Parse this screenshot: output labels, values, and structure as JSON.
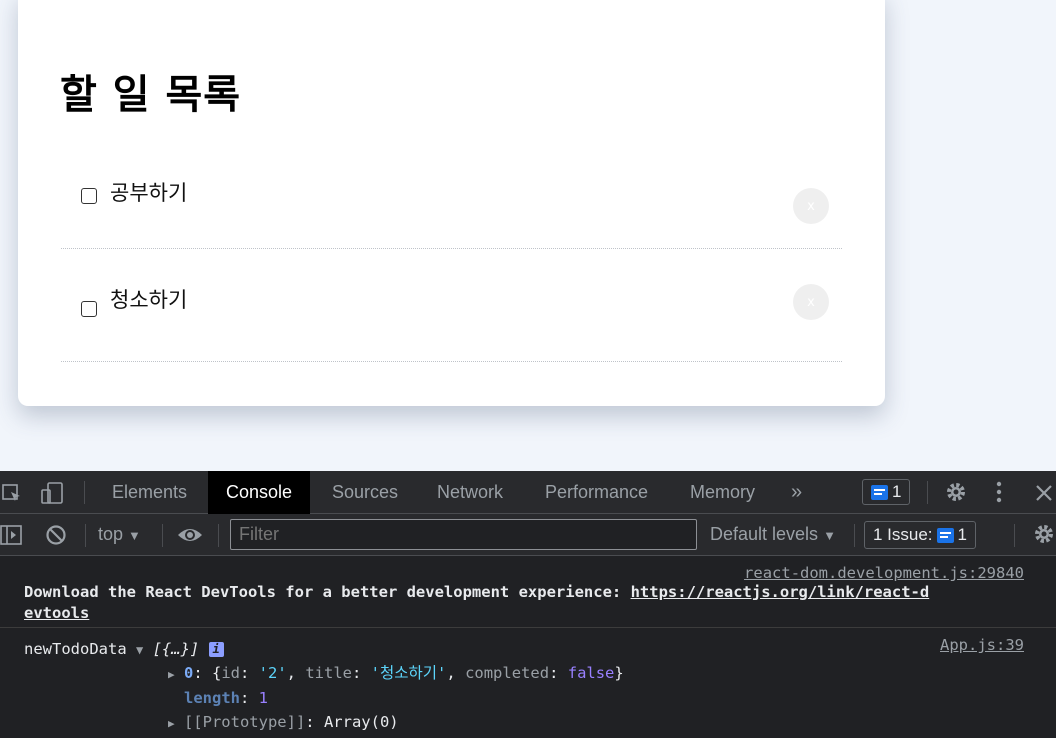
{
  "app": {
    "title": "할 일 목록",
    "todos": [
      {
        "label": "공부하기",
        "checked": false,
        "delete_label": "x"
      },
      {
        "label": "청소하기",
        "checked": false,
        "delete_label": "x"
      }
    ]
  },
  "devtools": {
    "tabs": [
      "Elements",
      "Console",
      "Sources",
      "Network",
      "Performance",
      "Memory"
    ],
    "active_tab": "Console",
    "more_tabs": "»",
    "message_count": "1",
    "filter_bar": {
      "context": "top",
      "filter_placeholder": "Filter",
      "levels": "Default levels",
      "issues_label": "1 Issue:",
      "issues_count": "1"
    },
    "console": {
      "msg1": {
        "source": "react-dom.development.js:29840",
        "text": "Download the React DevTools for a better development experience: ",
        "link": "https://reactjs.org/link/react-devtools",
        "link_line1": "https://reactjs.org/link/react-d",
        "link_line2": "evtools"
      },
      "msg2": {
        "label": "newTodoData",
        "summary": "[{…}]",
        "info": "i",
        "source": "App.js:39",
        "item_index": "0",
        "item_id_key": "id",
        "item_id_val": "'2'",
        "item_title_key": "title",
        "item_title_val": "'청소하기'",
        "item_completed_key": "completed",
        "item_completed_val": "false",
        "length_key": "length",
        "length_val": "1",
        "prototype_key": "[[Prototype]]",
        "prototype_val": "Array(0)"
      }
    },
    "colors": {
      "accent": "#1a73e8",
      "panel": "#202124",
      "toolbar": "#292a2d"
    }
  }
}
